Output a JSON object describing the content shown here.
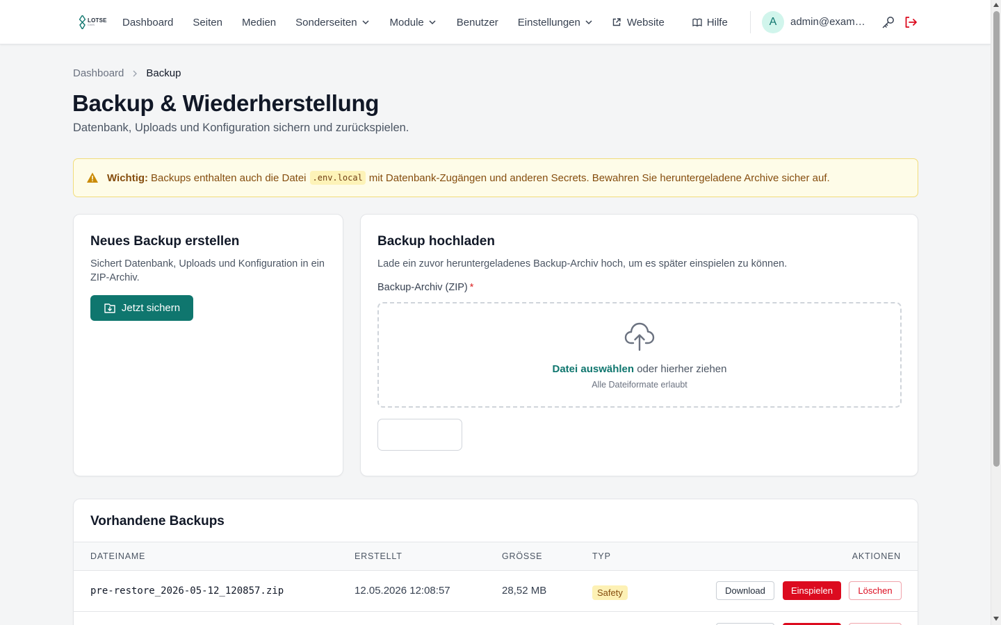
{
  "brand": {
    "logo_name": "LOTSE",
    "logo_sub": "CMS"
  },
  "nav": {
    "items": [
      {
        "label": "Dashboard",
        "dropdown": false
      },
      {
        "label": "Seiten",
        "dropdown": false
      },
      {
        "label": "Medien",
        "dropdown": false
      },
      {
        "label": "Sonderseiten",
        "dropdown": true
      },
      {
        "label": "Module",
        "dropdown": true
      },
      {
        "label": "Benutzer",
        "dropdown": false
      },
      {
        "label": "Einstellungen",
        "dropdown": true
      }
    ],
    "website_label": "Website",
    "help_label": "Hilfe",
    "avatar_initial": "A",
    "user_email": "admin@exampl..."
  },
  "breadcrumb": {
    "home": "Dashboard",
    "current": "Backup"
  },
  "page": {
    "title": "Backup & Wiederherstellung",
    "subtitle": "Datenbank, Uploads und Konfiguration sichern und zurückspielen."
  },
  "warning": {
    "strong": "Wichtig:",
    "text_before": "Backups enthalten auch die Datei",
    "code": ".env.local",
    "text_after": "mit Datenbank-Zugängen und anderen Secrets. Bewahren Sie heruntergeladene Archive sicher auf."
  },
  "create_card": {
    "title": "Neues Backup erstellen",
    "description": "Sichert Datenbank, Uploads und Konfiguration in ein ZIP-Archiv.",
    "button_label": "Jetzt sichern"
  },
  "upload_card": {
    "title": "Backup hochladen",
    "description": "Lade ein zuvor heruntergeladenes Backup-Archiv hoch, um es später einspielen zu können.",
    "field_label": "Backup-Archiv (ZIP)",
    "required_marker": "*",
    "choose_file": "Datei auswählen",
    "drop_text": "oder hierher ziehen",
    "hint": "Alle Dateiformate erlaubt"
  },
  "backups": {
    "title": "Vorhandene Backups",
    "columns": [
      "DATEINAME",
      "ERSTELLT",
      "GRÖSSE",
      "TYP",
      "AKTIONEN"
    ],
    "rows": [
      {
        "filename": "pre-restore_2026-05-12_120857.zip",
        "created": "12.05.2026 12:08:57",
        "size": "28,52 MB",
        "type": "Safety"
      }
    ],
    "actions": {
      "download": "Download",
      "restore": "Einspielen",
      "delete": "Löschen"
    }
  },
  "colors": {
    "accent": "#0f766e",
    "danger": "#dc0b1f",
    "warning_bg": "#fefce8",
    "warning_text": "#854d0e"
  }
}
